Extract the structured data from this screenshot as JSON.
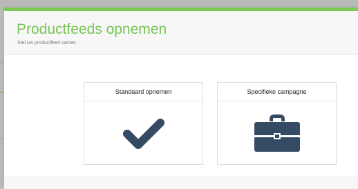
{
  "modal": {
    "title": "Productfeeds opnemen",
    "subtitle": "Stel uw productfeed samen",
    "accent_color": "#7dc855"
  },
  "options": [
    {
      "label": "Standaard opnemen",
      "icon": "checkmark-icon"
    },
    {
      "label": "Specifieke campagne",
      "icon": "briefcase-icon"
    }
  ],
  "icon_color": "#354a63"
}
